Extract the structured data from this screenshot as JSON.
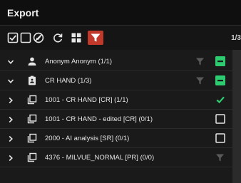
{
  "panel": {
    "title": "Export"
  },
  "toolbar": {
    "page_indicator": "1/3"
  },
  "tree": {
    "rows": [
      {
        "label": "Anonym Anonym (1/1)",
        "expanded": true,
        "check_state": "partial"
      },
      {
        "label": "CR HAND (1/3)",
        "expanded": true,
        "check_state": "partial"
      },
      {
        "label": "1001 - CR HAND [CR] (1/1)",
        "expanded": false,
        "check_state": "checked"
      },
      {
        "label": "1001 - CR HAND - edited [CR] (0/1)",
        "expanded": false,
        "check_state": "unchecked"
      },
      {
        "label": "2000 - AI analysis [SR] (0/1)",
        "expanded": false,
        "check_state": "unchecked"
      },
      {
        "label": "4376 - MILVUE_NORMAL [PR] (0/0)",
        "expanded": false,
        "check_state": "none"
      }
    ]
  },
  "colors": {
    "accent_green": "#2ecc71",
    "accent_red": "#c0392b",
    "icon_grey": "#5a5a5a"
  }
}
